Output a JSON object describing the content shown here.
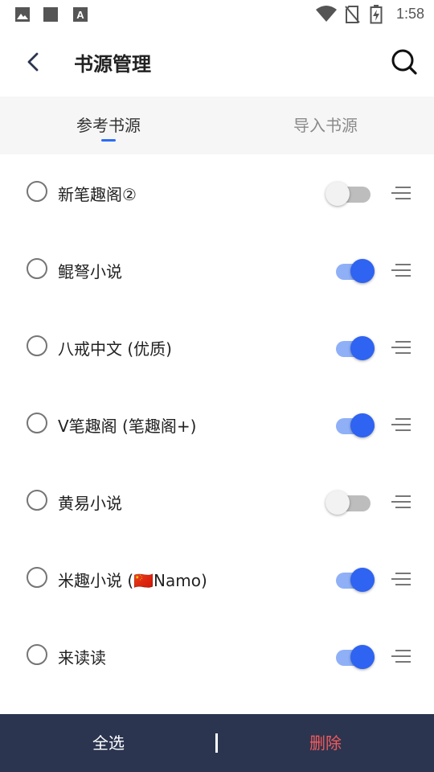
{
  "status_bar": {
    "time": "1:58",
    "icons": [
      "image-icon",
      "square-icon",
      "font-icon",
      "wifi-icon",
      "no-sim-icon",
      "battery-charging-icon"
    ]
  },
  "header": {
    "title": "书源管理",
    "back_icon": "back-arrow-icon",
    "search_icon": "search-icon"
  },
  "tabs": [
    {
      "label": "参考书源",
      "active": true
    },
    {
      "label": "导入书源",
      "active": false
    }
  ],
  "sources": [
    {
      "name": "新笔趣阁②",
      "enabled": false
    },
    {
      "name": "鲲弩小说",
      "enabled": true
    },
    {
      "name": "八戒中文 (优质)",
      "enabled": true
    },
    {
      "name": "V笔趣阁 (笔趣阁+)",
      "enabled": true
    },
    {
      "name": "黄易小说",
      "enabled": false
    },
    {
      "name": "米趣小说 (🇨🇳Namo)",
      "enabled": true
    },
    {
      "name": "来读读",
      "enabled": true
    }
  ],
  "bottom_bar": {
    "select_all": "全选",
    "delete": "删除"
  },
  "colors": {
    "accent": "#2f63f1",
    "bottom_bar_bg": "#2b3550",
    "delete_text": "#f45a5a",
    "tab_bg": "#f6f6f6"
  }
}
